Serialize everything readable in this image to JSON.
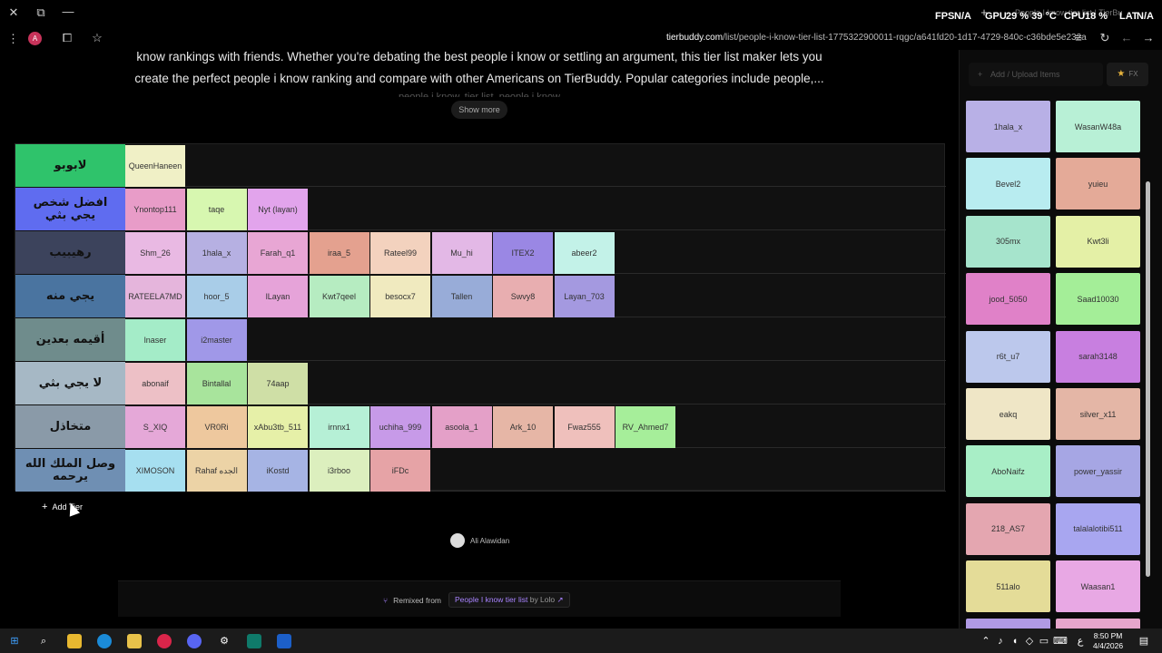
{
  "browser": {
    "tab_title": "People I know tier list | TierBu",
    "url_host": "tierbuddy.com",
    "url_path": "/list/people-i-know-tier-list-1775322900011-rqgc/a641fd20-1d17-4729-840c-c36bde5e232a",
    "overlay": {
      "fps_label": "FPS",
      "fps_value": "N/A",
      "gpu_label": "GPU",
      "gpu_value": "29 % 39 °C",
      "cpu_label": "CPU",
      "cpu_value": "18 %",
      "lat_label": "LAT",
      "lat_value": "N/A"
    }
  },
  "page": {
    "desc_line1": "know rankings with friends. Whether you're debating the best people i know or settling an argument, this tier list maker lets you",
    "desc_line2": "create the perfect people i know ranking and compare with other Americans on TierBuddy. Popular categories include people,...",
    "desc_line3": "people i know, tier list, people i know",
    "show_more": "Show more",
    "add_tier": "Add Tier",
    "creator_name": "Ali Alawidan",
    "remixed_from_label": "Remixed from",
    "remix_link": "People I know tier list",
    "remix_by": "by Lolo"
  },
  "tiers": [
    {
      "label": "لابوبو",
      "color": "#2fc36b",
      "items": [
        {
          "name": "QueenHaneen",
          "color": "#f0f0c6"
        }
      ]
    },
    {
      "label": "افضل شخص يجي بثي",
      "color": "#5f6cf0",
      "items": [
        {
          "name": "Ynontop111",
          "color": "#e89cc8"
        },
        {
          "name": "taqe",
          "color": "#d7f7b0"
        },
        {
          "name": "Nyt (layan)",
          "color": "#e2a4ec"
        }
      ]
    },
    {
      "label": "رهيبيب",
      "color": "#3c435c",
      "items": [
        {
          "name": "Shm_26",
          "color": "#e9b9e3"
        },
        {
          "name": "1hala_x",
          "color": "#b6b0e2"
        },
        {
          "name": "Farah_q1",
          "color": "#e8a6d4"
        },
        {
          "name": "iraa_5",
          "color": "#e4a18f"
        },
        {
          "name": "Rateel99",
          "color": "#f3d2be"
        },
        {
          "name": "Mu_hi",
          "color": "#e3b8e6"
        },
        {
          "name": "ITEX2",
          "color": "#9a87e4"
        },
        {
          "name": "abeer2",
          "color": "#c3f2e8"
        }
      ]
    },
    {
      "label": "يجي منه",
      "color": "#4a74a0",
      "items": [
        {
          "name": "RATEELA7MD",
          "color": "#e5b5dc"
        },
        {
          "name": "hoor_5",
          "color": "#a9cde8"
        },
        {
          "name": "lLayan",
          "color": "#e6a3d9"
        },
        {
          "name": "Kwt7qeel",
          "color": "#b6ecc1"
        },
        {
          "name": "besocx7",
          "color": "#f0eabf"
        },
        {
          "name": "Tallen",
          "color": "#98acd8"
        },
        {
          "name": "Swvy8",
          "color": "#e8aeb0"
        },
        {
          "name": "Layan_703",
          "color": "#a499e0"
        }
      ]
    },
    {
      "label": "أقيمه بعدين",
      "color": "#6f8c8c",
      "items": [
        {
          "name": "lnaser",
          "color": "#a4ecc8"
        },
        {
          "name": "i2master",
          "color": "#a098e8"
        }
      ]
    },
    {
      "label": "لا يجي بثي",
      "color": "#a6b8c5",
      "items": [
        {
          "name": "abonaif",
          "color": "#edc0c6"
        },
        {
          "name": "Bintallal",
          "color": "#a8e49c"
        },
        {
          "name": "74aap",
          "color": "#cfdfa6"
        }
      ]
    },
    {
      "label": "متخاذل",
      "color": "#8a9aa8",
      "items": [
        {
          "name": "S_XIQ",
          "color": "#e5a8d8"
        },
        {
          "name": "VR0Ri",
          "color": "#eec89e"
        },
        {
          "name": "xAbu3tb_511",
          "color": "#e6f0a8"
        },
        {
          "name": "irnnx1",
          "color": "#b6f0d6"
        },
        {
          "name": "uchiha_999",
          "color": "#c79ae8"
        },
        {
          "name": "asoola_1",
          "color": "#e4a0c8"
        },
        {
          "name": "Ark_10",
          "color": "#e6b6a6"
        },
        {
          "name": "Fwaz555",
          "color": "#efc0bc"
        },
        {
          "name": "RV_Ahmed7",
          "color": "#a6ee9a"
        }
      ]
    },
    {
      "label": "وصل الملك الله يرحمه",
      "color": "#6f8fb3",
      "items": [
        {
          "name": "XIMOSON",
          "color": "#a6dff0"
        },
        {
          "name": "Rahaf الجده",
          "color": "#ecd3a6"
        },
        {
          "name": "iKostd",
          "color": "#a6b4e4"
        },
        {
          "name": "i3rboo",
          "color": "#dcefbe"
        },
        {
          "name": "iFDc",
          "color": "#e6a3a6"
        }
      ]
    }
  ],
  "sidebar": {
    "upload_placeholder": "Add / Upload Items",
    "fx_label": "FX",
    "items": [
      {
        "name": "1hala_x",
        "color": "#b8b0e6"
      },
      {
        "name": "WasanW48a",
        "color": "#b8f0d6"
      },
      {
        "name": "Bevel2",
        "color": "#b8ecf0"
      },
      {
        "name": "yuieu",
        "color": "#e4aa98"
      },
      {
        "name": "305mx",
        "color": "#a6e4cc"
      },
      {
        "name": "Kwt3li",
        "color": "#e4f0a6"
      },
      {
        "name": "jood_5050",
        "color": "#e081c8"
      },
      {
        "name": "Saad10030",
        "color": "#a4ee98"
      },
      {
        "name": "r6t_u7",
        "color": "#bcc8ec"
      },
      {
        "name": "sarah3148",
        "color": "#c87fe0"
      },
      {
        "name": "eakq",
        "color": "#efe6c6"
      },
      {
        "name": "silver_x11",
        "color": "#e4b6a6"
      },
      {
        "name": "AboNaifz",
        "color": "#a8eec6"
      },
      {
        "name": "power_yassir",
        "color": "#a6a6e4"
      },
      {
        "name": "218_AS7",
        "color": "#e4a6b0"
      },
      {
        "name": "talalalotibi511",
        "color": "#a8a6f0"
      },
      {
        "name": "511alo",
        "color": "#e4dc98"
      },
      {
        "name": "Waasan1",
        "color": "#e8a8e4"
      },
      {
        "name": "",
        "color": "#b09ae4"
      },
      {
        "name": "",
        "color": "#e6a6cc"
      }
    ]
  },
  "taskbar": {
    "time": "8:50 PM",
    "date": "4/4/2026",
    "lang": "ع"
  }
}
